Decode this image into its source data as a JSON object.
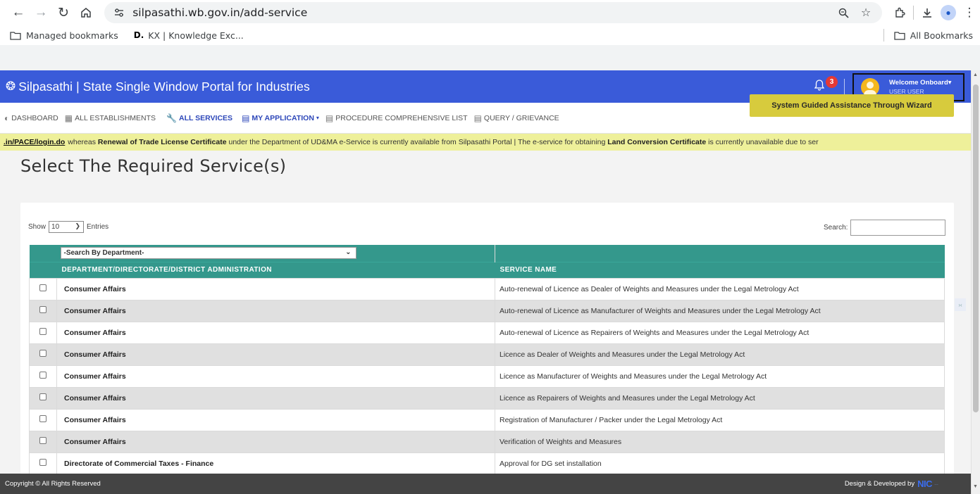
{
  "browser": {
    "url": "silpasathi.wb.gov.in/add-service",
    "bookmarks": [
      {
        "label": "Managed bookmarks"
      },
      {
        "label": "KX | Knowledge Exc...",
        "badge": "D."
      }
    ],
    "all_bookmarks": "All Bookmarks"
  },
  "app": {
    "title": "Silpasathi | State Single Window Portal for Industries",
    "notification_count": "3",
    "welcome": "Welcome Onboard",
    "username": "USER USER",
    "brand_color": "#3a5bd9"
  },
  "menu": [
    {
      "label": "DASHBOARD",
      "icon": "speedometer-icon"
    },
    {
      "label": "ALL ESTABLISHMENTS",
      "icon": "building-icon"
    },
    {
      "label": "ALL SERVICES",
      "icon": "wrench-icon",
      "active": true
    },
    {
      "label": "MY APPLICATION",
      "icon": "document-icon",
      "dropdown": true
    },
    {
      "label": "PROCEDURE COMPREHENSIVE LIST",
      "icon": "list-icon"
    },
    {
      "label": "QUERY / GRIEVANCE",
      "icon": "list-icon"
    }
  ],
  "ticker": {
    "link": ".in/PACE/login.do",
    "t1": "whereas",
    "b1": "Renewal of Trade License Certificate",
    "t2": "under the Department of UD&MA e-Service is currently available from Silpasathi Portal | The e-service for obtaining",
    "b2": "Land Conversion Certificate",
    "t3": "is currently unavailable due to ser"
  },
  "page": {
    "title": "Select The Required Service(s)",
    "wizard_button": "System Guided Assistance Through Wizard"
  },
  "table_controls": {
    "show": "Show",
    "length": "10",
    "entries": "Entries",
    "search_label": "Search:",
    "search_value": "",
    "dept_filter": "-Search By Department-"
  },
  "table": {
    "headers": [
      "DEPARTMENT/DIRECTORATE/DISTRICT ADMINISTRATION",
      "SERVICE NAME"
    ],
    "rows": [
      {
        "dept": "Consumer Affairs",
        "service": "Auto-renewal of Licence as Dealer of Weights and Measures under the Legal Metrology Act"
      },
      {
        "dept": "Consumer Affairs",
        "service": "Auto-renewal of Licence as Manufacturer of Weights and Measures under the Legal Metrology Act"
      },
      {
        "dept": "Consumer Affairs",
        "service": "Auto-renewal of Licence as Repairers of Weights and Measures under the Legal Metrology Act"
      },
      {
        "dept": "Consumer Affairs",
        "service": "Licence as Dealer of Weights and Measures under the Legal Metrology Act"
      },
      {
        "dept": "Consumer Affairs",
        "service": "Licence as Manufacturer of Weights and Measures under the Legal Metrology Act"
      },
      {
        "dept": "Consumer Affairs",
        "service": "Licence as Repairers of Weights and Measures under the Legal Metrology Act"
      },
      {
        "dept": "Consumer Affairs",
        "service": "Registration of Manufacturer / Packer under the Legal Metrology Act"
      },
      {
        "dept": "Consumer Affairs",
        "service": "Verification of Weights and Measures"
      },
      {
        "dept": "Directorate of Commercial Taxes - Finance",
        "service": "Approval for DG set installation"
      }
    ]
  },
  "footer": {
    "copyright": "Copyright © All Rights Reserved",
    "credit": "Design & Developed by",
    "nic": "NIC"
  }
}
